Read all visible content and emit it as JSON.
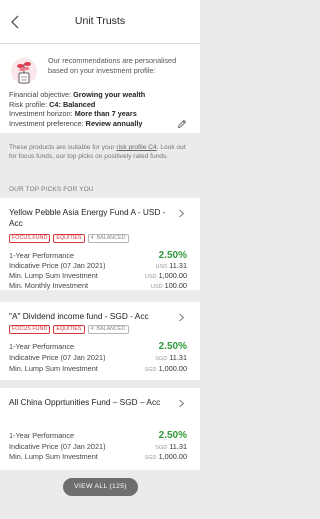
{
  "header": {
    "title": "Unit Trusts"
  },
  "profile": {
    "intro": "Our recommendations are personalised based on your investment profile:",
    "lines": [
      {
        "label": "Financial objective:",
        "value": "Growing your wealth"
      },
      {
        "label": "Risk profile:",
        "value": "C4: Balanced"
      },
      {
        "label": "Investment horizon:",
        "value": "More than 7 years"
      },
      {
        "label": "Investment preference:",
        "value": "Review annually"
      }
    ]
  },
  "note": {
    "part1": "These products are suitable for your ",
    "link": "risk profile C4",
    "part2": ". Look out for focus funds, our top picks on positively rated funds."
  },
  "section_title": "OUR TOP PICKS FOR YOU",
  "funds": [
    {
      "name": "Yellow Pebble Asia Energy Fund A - USD - Acc",
      "tags": [
        "FOCUS FUND",
        "EQUITIES",
        "4: BALANCED"
      ],
      "perf_label": "1-Year Performance",
      "perf_value": "2.50%",
      "price_label": "Indicative Price (07 Jan 2021)",
      "price_cur": "USD",
      "price_value": "11.31",
      "lump_label": "Min. Lump Sum Investment",
      "lump_cur": "USD",
      "lump_value": "1,000.00",
      "monthly_label": "Min. Monthly Investment",
      "monthly_cur": "USD",
      "monthly_value": "100.00"
    },
    {
      "name": "\"A\" Dividend income fund - SGD - Acc",
      "tags": [
        "FOCUS FUND",
        "EQUITIES",
        "4: BALANCED"
      ],
      "perf_label": "1-Year Performance",
      "perf_value": "2.50%",
      "price_label": "Indicative Price (07 Jan 2021)",
      "price_cur": "SGD",
      "price_value": "11.31",
      "lump_label": "Min. Lump Sum Investment",
      "lump_cur": "SGD",
      "lump_value": "1,000.00"
    },
    {
      "name": "All China Opprtunities Fund – SGD – Acc",
      "perf_label": "1-Year Performance",
      "perf_value": "2.50%",
      "price_label": "Indicative Price (07 Jan 2021)",
      "price_cur": "SGD",
      "price_value": "11.31",
      "lump_label": "Min. Lump Sum Investment",
      "lump_cur": "SGD",
      "lump_value": "1,000.00"
    }
  ],
  "view_all": "VIEW ALL (125)",
  "colors": {
    "focus": "#d63a3a",
    "performance": "#2e9a3a",
    "button": "#6e6e6e"
  }
}
